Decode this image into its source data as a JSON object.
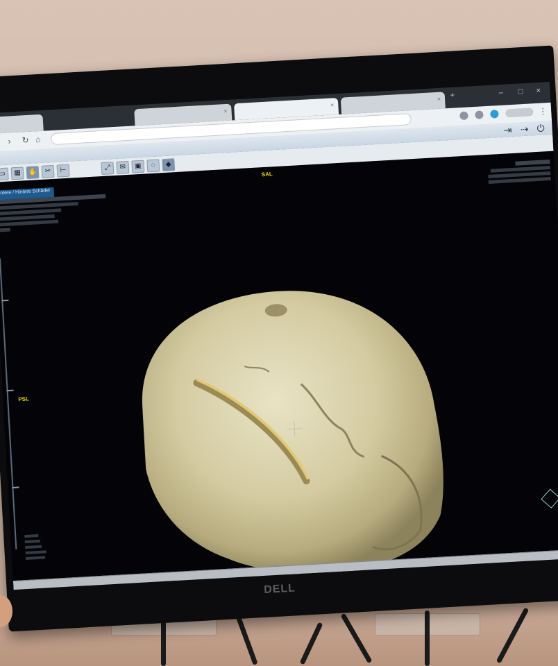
{
  "viewer": {
    "orientation_top": "SAL",
    "orientation_left": "PSL",
    "series_title": "Hintere / Hintere Schädel",
    "brand_logo": "DELL"
  },
  "icons": [
    "back-icon",
    "forward-icon",
    "refresh-icon",
    "home-icon",
    "close-tab-icon",
    "bookmark-icon",
    "profile-icon",
    "menu-icon",
    "logout-icon",
    "share-icon",
    "power-icon",
    "cursor-icon",
    "rotate-icon",
    "hand-icon",
    "pan-icon",
    "zoom-icon",
    "measure-icon",
    "envelope-icon",
    "camera-icon",
    "settings-icon",
    "3d-icon",
    "orientation-cube-icon",
    "crosshair-icon"
  ],
  "colors": {
    "orientation_label": "#e8d000",
    "series_tag": "#1f5a8f",
    "skull": "#d9d1a8",
    "viewport_bg": "#040408"
  }
}
